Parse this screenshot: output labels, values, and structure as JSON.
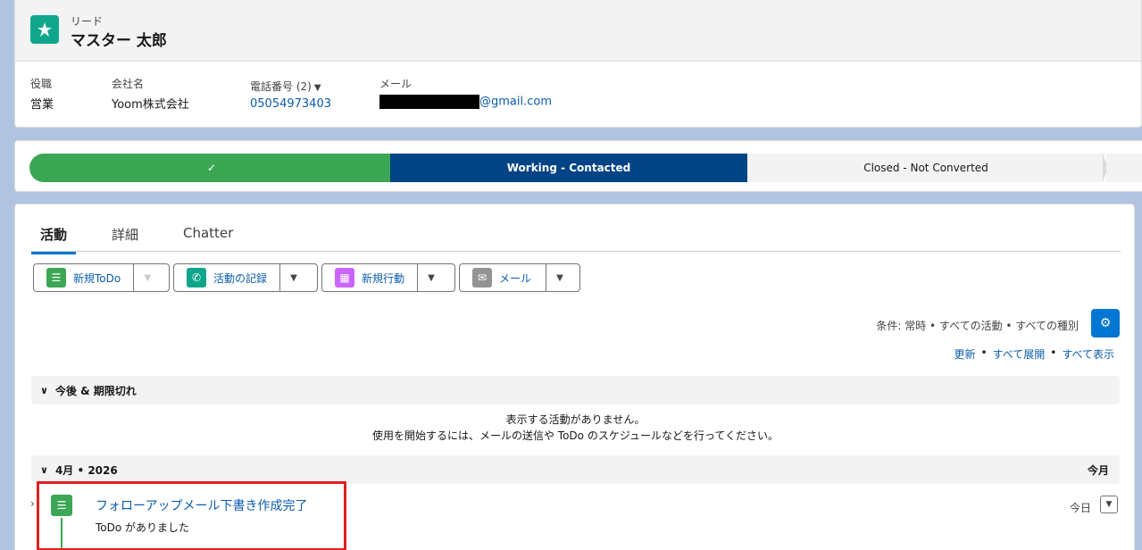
{
  "header": {
    "object_label": "リード",
    "record_name": "マスター 太郎",
    "fields": {
      "title_label": "役職",
      "title_value": "営業",
      "company_label": "会社名",
      "company_value": "Yoom株式会社",
      "phone_label": "電話番号 (2)",
      "phone_value": "05054973403",
      "email_label": "メール",
      "email_domain": "@gmail.com"
    }
  },
  "path": {
    "complete_mark": "✓",
    "current": "Working - Contacted",
    "next": "Closed - Not Converted",
    "colors": {
      "complete": "#3ba755",
      "current": "#014486",
      "upcoming": "#f3f3f3"
    }
  },
  "tabs": [
    {
      "label": "活動",
      "active": true
    },
    {
      "label": "詳細",
      "active": false
    },
    {
      "label": "Chatter",
      "active": false
    }
  ],
  "actions": {
    "new_todo": "新規ToDo",
    "log_activity": "活動の記録",
    "new_event": "新規行動",
    "email": "メール"
  },
  "filter": {
    "text": "条件: 常時 • すべての活動 • すべての種別",
    "refresh": "更新",
    "expand_all": "すべて展開",
    "show_all": "すべて表示"
  },
  "upcoming": {
    "title": "今後 & 期限切れ",
    "empty_line1": "表示する活動がありません。",
    "empty_line2": "使用を開始するには、メールの送信や ToDo のスケジュールなどを行ってください。"
  },
  "month_section": {
    "title": "4月 • 2026",
    "right_label": "今月"
  },
  "timeline_item": {
    "title": "フォローアップメール下書き作成完了",
    "subtitle": "ToDo がありました",
    "date": "今日"
  }
}
